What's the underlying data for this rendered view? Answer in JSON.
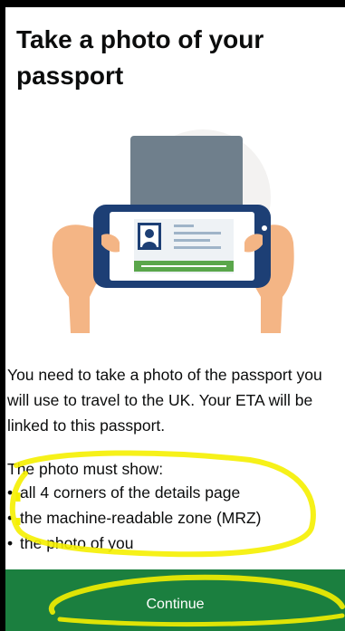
{
  "page": {
    "title": "Take a photo of your passport",
    "intro": "You need to take a photo of the passport you will use to travel to the UK. Your ETA will be linked to this passport.",
    "must_show_heading": "The photo must show:",
    "requirements": [
      "all 4 corners of the details page",
      "the machine-readable zone (MRZ)",
      "the photo of you"
    ],
    "bullet_glyph": "•"
  },
  "footer": {
    "continue_label": "Continue"
  },
  "colors": {
    "button_green": "#1b7f3f",
    "highlight_yellow": "#f5f000",
    "passport_grey": "#6f7f8c",
    "phone_blue": "#1d3f75",
    "screen_green": "#5aa64b",
    "skin": "#f4b585"
  },
  "icons": [
    "phone-scanning-passport-illustration"
  ]
}
